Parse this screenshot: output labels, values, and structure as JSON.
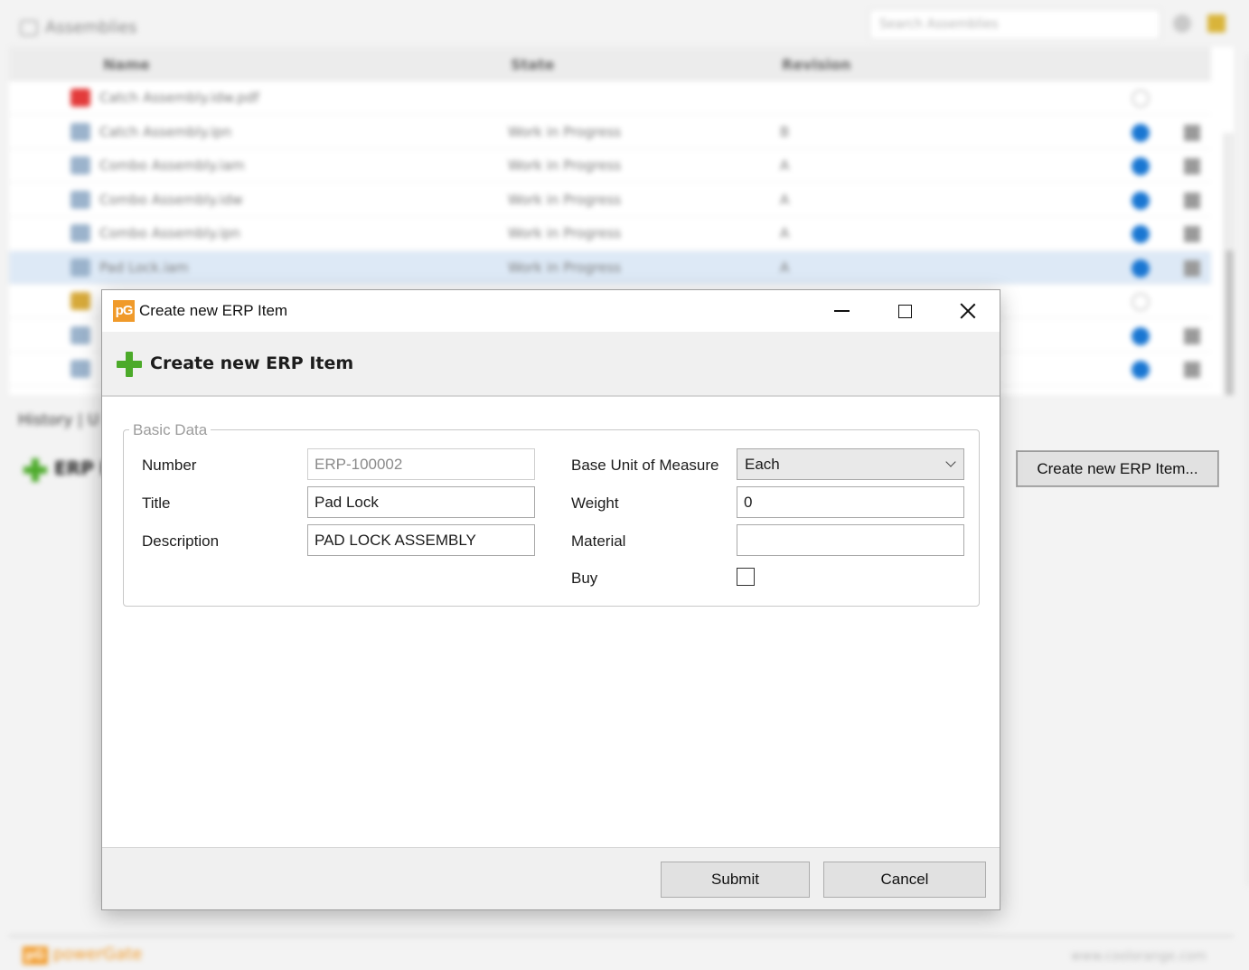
{
  "background": {
    "panel_title": "Assemblies",
    "search_placeholder": "Search Assemblies",
    "columns": [
      "Name",
      "State",
      "Revision"
    ],
    "rows": [
      {
        "name": "Catch Assembly.idw.pdf",
        "state": "",
        "revision": "",
        "icon": "pdf-file-icon",
        "status": "none"
      },
      {
        "name": "Catch Assembly.ipn",
        "state": "Work in Progress",
        "revision": "B",
        "icon": "presentation-file-icon",
        "status": "blue"
      },
      {
        "name": "Combo Assembly.iam",
        "state": "Work in Progress",
        "revision": "A",
        "icon": "assembly-file-icon",
        "status": "blue"
      },
      {
        "name": "Combo Assembly.idw",
        "state": "Work in Progress",
        "revision": "A",
        "icon": "drawing-file-icon",
        "status": "blue"
      },
      {
        "name": "Combo Assembly.ipn",
        "state": "Work in Progress",
        "revision": "A",
        "icon": "presentation-file-icon",
        "status": "blue"
      },
      {
        "name": "Pad Lock.iam",
        "state": "Work in Progress",
        "revision": "A",
        "icon": "assembly-file-icon",
        "status": "blue",
        "selected": true
      },
      {
        "name": "",
        "state": "",
        "revision": "",
        "icon": "image-file-icon",
        "status": "none"
      },
      {
        "name": "",
        "state": "",
        "revision": "",
        "icon": "drawing-file-icon",
        "status": "blue"
      },
      {
        "name": "",
        "state": "",
        "revision": "",
        "icon": "presentation-file-icon",
        "status": "blue"
      }
    ],
    "tabs_text": "History  |  U",
    "erp_label": "ERP I",
    "create_button_label": "Create new ERP Item...",
    "brand": "powerGate",
    "brand_logo": "pG",
    "website": "www.coolorange.com"
  },
  "dialog": {
    "window_title": "Create new ERP Item",
    "app_icon_text": "pG",
    "heading": "Create new ERP Item",
    "group_title": "Basic Data",
    "fields": {
      "number": {
        "label": "Number",
        "value": "ERP-100002"
      },
      "title": {
        "label": "Title",
        "value": "Pad Lock"
      },
      "description": {
        "label": "Description",
        "value": "PAD LOCK ASSEMBLY"
      },
      "base_unit": {
        "label": "Base Unit of Measure",
        "value": "Each"
      },
      "weight": {
        "label": "Weight",
        "value": "0"
      },
      "material": {
        "label": "Material",
        "value": ""
      },
      "buy": {
        "label": "Buy",
        "checked": false
      }
    },
    "buttons": {
      "submit": "Submit",
      "cancel": "Cancel"
    }
  },
  "colors": {
    "accent_green": "#4caa2a",
    "brand_orange": "#f09a2a",
    "status_blue": "#1976d2",
    "selection": "#dde9f6"
  }
}
